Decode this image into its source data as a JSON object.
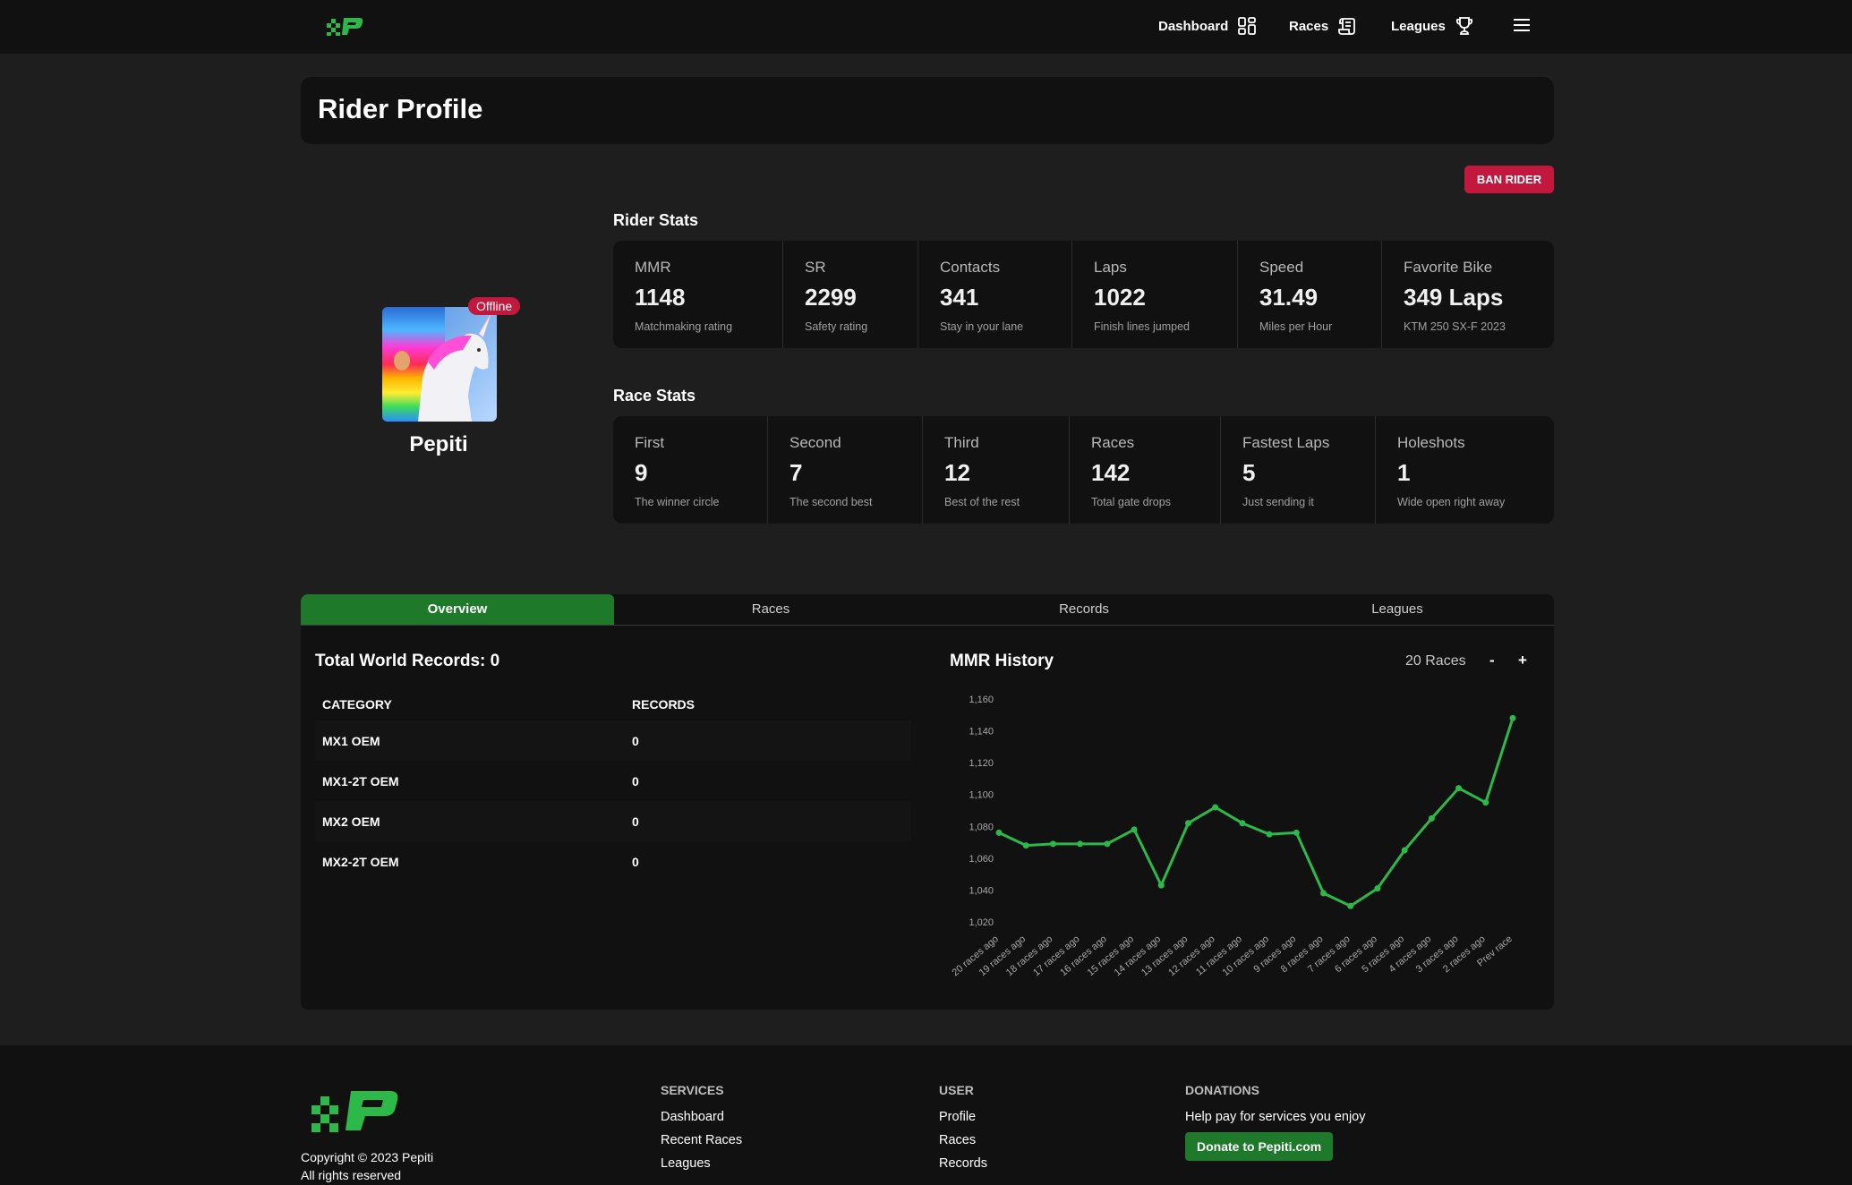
{
  "nav": {
    "dashboard": "Dashboard",
    "races": "Races",
    "leagues": "Leagues"
  },
  "page_title": "Rider Profile",
  "ban_button": "BAN RIDER",
  "rider": {
    "name": "Pepiti",
    "status": "Offline"
  },
  "rider_stats": {
    "title": "Rider Stats",
    "items": [
      {
        "label": "MMR",
        "value": "1148",
        "sub": "Matchmaking rating"
      },
      {
        "label": "SR",
        "value": "2299",
        "sub": "Safety rating"
      },
      {
        "label": "Contacts",
        "value": "341",
        "sub": "Stay in your lane"
      },
      {
        "label": "Laps",
        "value": "1022",
        "sub": "Finish lines jumped"
      },
      {
        "label": "Speed",
        "value": "31.49",
        "sub": "Miles per Hour"
      },
      {
        "label": "Favorite Bike",
        "value": "349 Laps",
        "sub": "KTM 250 SX-F 2023"
      }
    ]
  },
  "race_stats": {
    "title": "Race Stats",
    "items": [
      {
        "label": "First",
        "value": "9",
        "sub": "The winner circle"
      },
      {
        "label": "Second",
        "value": "7",
        "sub": "The second best"
      },
      {
        "label": "Third",
        "value": "12",
        "sub": "Best of the rest"
      },
      {
        "label": "Races",
        "value": "142",
        "sub": "Total gate drops"
      },
      {
        "label": "Fastest Laps",
        "value": "5",
        "sub": "Just sending it"
      },
      {
        "label": "Holeshots",
        "value": "1",
        "sub": "Wide open right away"
      }
    ]
  },
  "tabs": [
    "Overview",
    "Races",
    "Records",
    "Leagues"
  ],
  "active_tab": "Overview",
  "world_records": {
    "title": "Total World Records:",
    "total": "0",
    "headers": [
      "CATEGORY",
      "RECORDS"
    ],
    "rows": [
      {
        "category": "MX1 OEM",
        "records": "0"
      },
      {
        "category": "MX1-2T OEM",
        "records": "0"
      },
      {
        "category": "MX2 OEM",
        "records": "0"
      },
      {
        "category": "MX2-2T OEM",
        "records": "0"
      }
    ]
  },
  "mmr_history": {
    "title": "MMR History",
    "count_label": "20 Races",
    "minus": "-",
    "plus": "+"
  },
  "chart_data": {
    "type": "line",
    "title": "MMR History",
    "xlabel": "",
    "ylabel": "",
    "categories": [
      "20 races ago",
      "19 races ago",
      "18 races ago",
      "17 races ago",
      "16 races ago",
      "15 races ago",
      "14 races ago",
      "13 races ago",
      "12 races ago",
      "11 races ago",
      "10 races ago",
      "9 races ago",
      "8 races ago",
      "7 races ago",
      "6 races ago",
      "5 races ago",
      "4 races ago",
      "3 races ago",
      "2 races ago",
      "Prev race"
    ],
    "values": [
      1076,
      1068,
      1069,
      1069,
      1069,
      1078,
      1043,
      1082,
      1092,
      1082,
      1075,
      1076,
      1038,
      1030,
      1041,
      1065,
      1085,
      1104,
      1095,
      1148
    ],
    "ylim": [
      1020,
      1160
    ],
    "yticks": [
      "1,020",
      "1,040",
      "1,060",
      "1,080",
      "1,100",
      "1,120",
      "1,140",
      "1,160"
    ],
    "color": "#2db84a"
  },
  "footer": {
    "copyright": "Copyright © 2023 Pepiti",
    "rights": "All rights reserved",
    "services": {
      "title": "SERVICES",
      "links": [
        "Dashboard",
        "Recent Races",
        "Leagues"
      ]
    },
    "user": {
      "title": "USER",
      "links": [
        "Profile",
        "Races",
        "Records"
      ]
    },
    "donations": {
      "title": "DONATIONS",
      "text": "Help pay for services you enjoy",
      "button": "Donate to Pepiti.com"
    }
  },
  "colors": {
    "accent": "#1e7a2a",
    "danger": "#c2183d",
    "line": "#2db84a"
  }
}
